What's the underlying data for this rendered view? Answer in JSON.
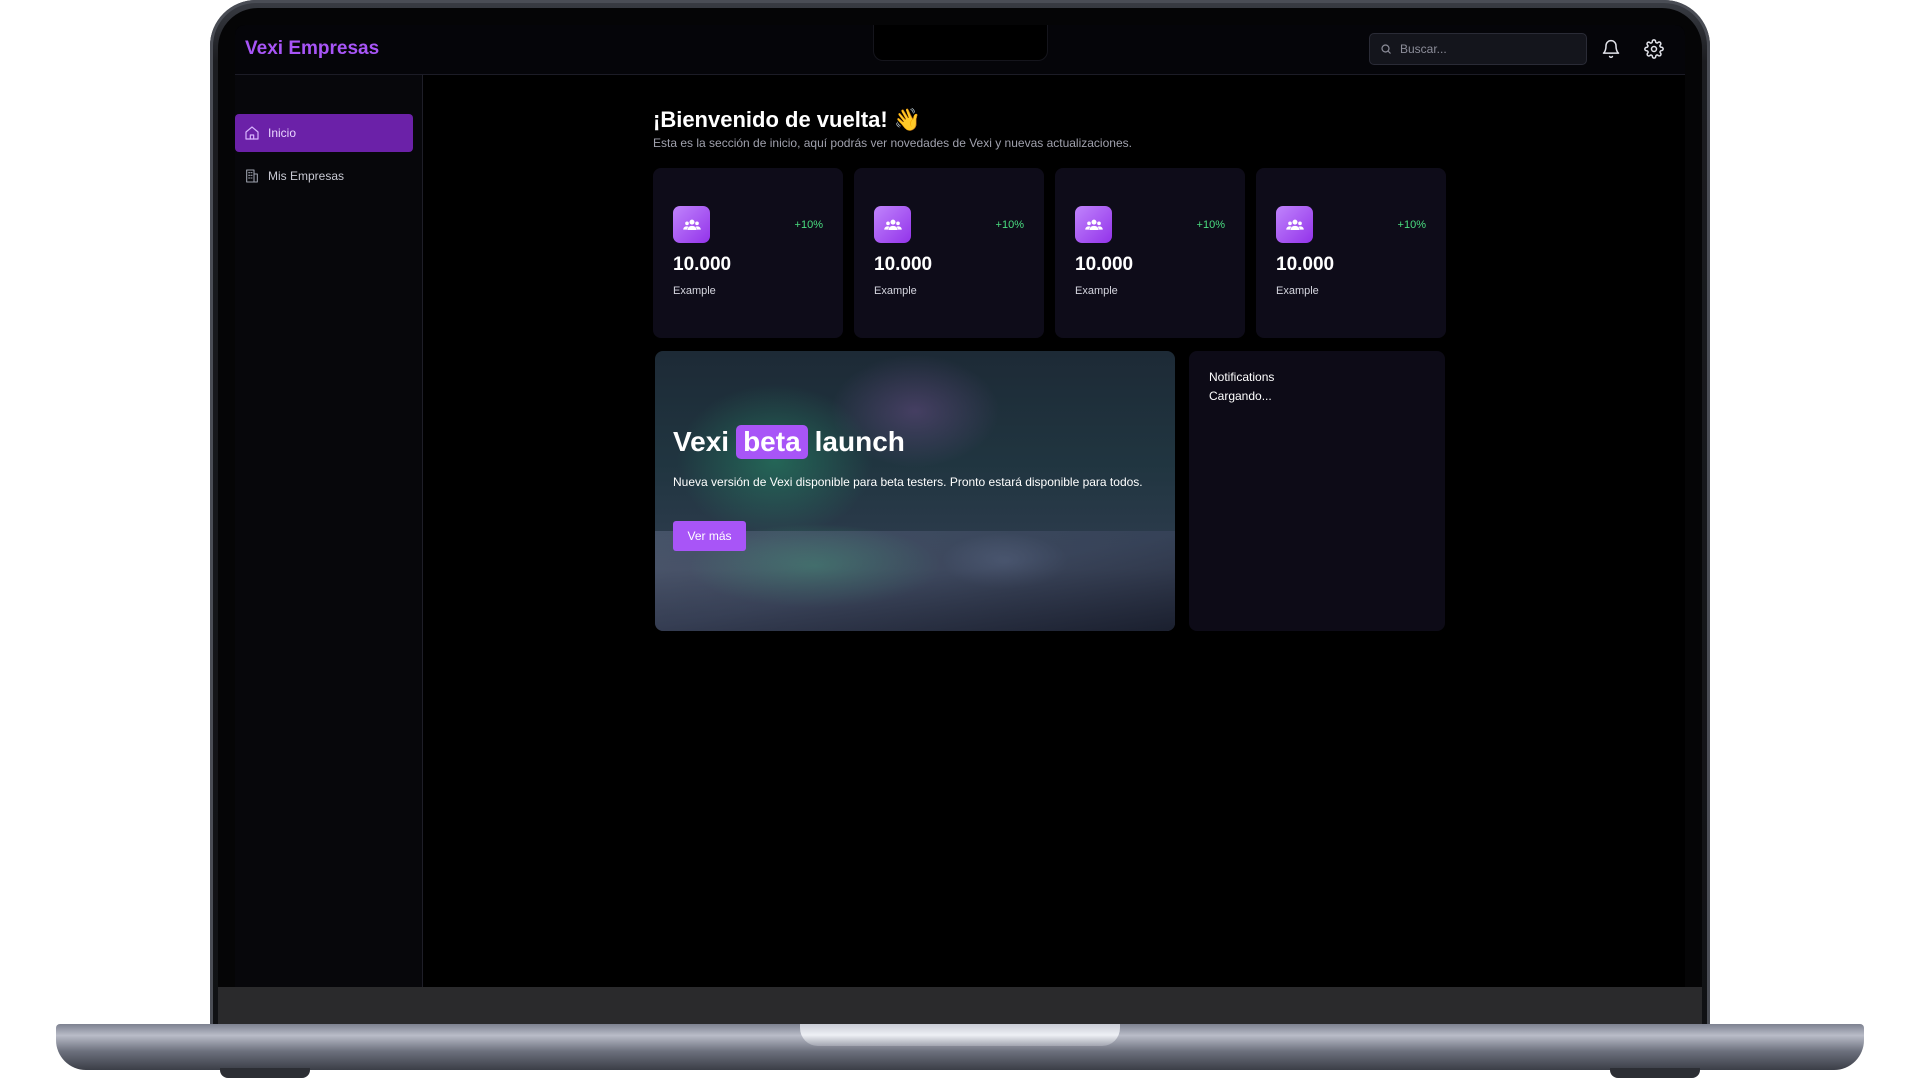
{
  "app": {
    "brand": "Vexi Empresas"
  },
  "header": {
    "search_placeholder": "Buscar...",
    "icons": [
      "search-icon",
      "bell-icon",
      "gear-icon"
    ]
  },
  "sidebar": {
    "items": [
      {
        "label": "Inicio",
        "icon": "home-icon",
        "active": true
      },
      {
        "label": "Mis Empresas",
        "icon": "building-icon",
        "active": false
      }
    ]
  },
  "main": {
    "welcome_title": "¡Bienvenido de vuelta! 👋",
    "welcome_subtitle": "Esta es la sección de inicio, aquí podrás ver novedades de Vexi y nuevas actualizaciones.",
    "stats": [
      {
        "value": "10.000",
        "label": "Example",
        "delta": "+10%",
        "icon": "users-icon"
      },
      {
        "value": "10.000",
        "label": "Example",
        "delta": "+10%",
        "icon": "users-icon"
      },
      {
        "value": "10.000",
        "label": "Example",
        "delta": "+10%",
        "icon": "users-icon"
      },
      {
        "value": "10.000",
        "label": "Example",
        "delta": "+10%",
        "icon": "users-icon"
      }
    ],
    "banner": {
      "title_before": "Vexi",
      "title_highlight": "beta",
      "title_after": "launch",
      "description": "Nueva versión de Vexi disponible para beta testers. Pronto estará disponible para todos.",
      "button_label": "Ver más"
    },
    "notifications": {
      "title": "Notifications",
      "status": "Cargando..."
    }
  },
  "colors": {
    "accent": "#a855f7",
    "active_nav": "#6b21a8",
    "positive": "#4ade80",
    "card_bg": "#0e0c19"
  }
}
